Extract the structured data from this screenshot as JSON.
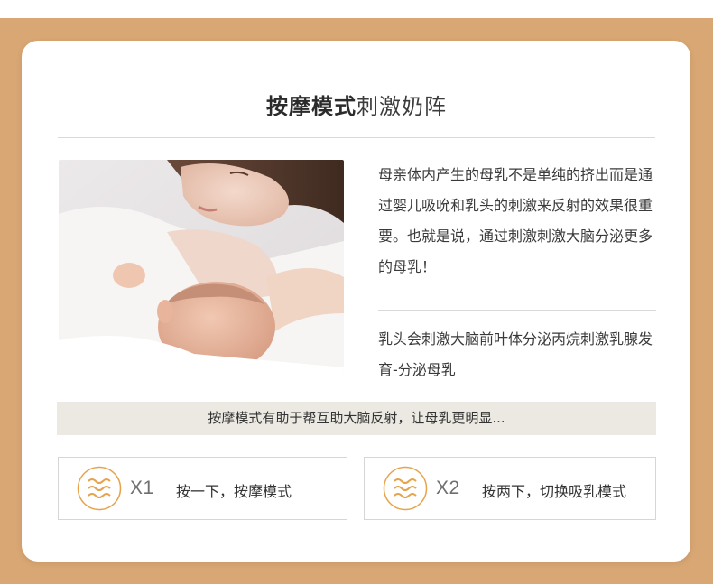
{
  "colors": {
    "band": "#d8a774",
    "accent": "#e5a44c",
    "banner_bg": "#ebe9e1"
  },
  "header": {
    "title_bold": "按摩模式",
    "title_normal": "刺激奶阵"
  },
  "intro": {
    "paragraph1": "母亲体内产生的母乳不是单纯的挤出而是通过婴儿吸吮和乳头的刺激来反射的效果很重要。也就是说，通过刺激刺激大脑分泌更多的母乳！",
    "paragraph2": "乳头会刺激大脑前叶体分泌丙烷刺激乳腺发育-分泌母乳"
  },
  "banner": {
    "text": "按摩模式有助于帮互助大脑反射，让母乳更明显..."
  },
  "modes": [
    {
      "icon": "wave-icon",
      "count": "X1",
      "label": "按一下，按摩模式"
    },
    {
      "icon": "wave-icon",
      "count": "X2",
      "label": "按两下，切换吸乳模式"
    }
  ]
}
